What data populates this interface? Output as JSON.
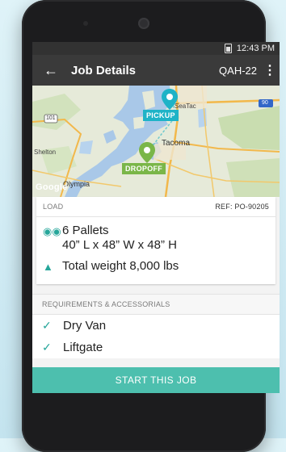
{
  "status": {
    "time": "12:43 PM"
  },
  "appbar": {
    "title": "Job Details",
    "job_code": "QAH-22"
  },
  "map": {
    "pickup_label": "PICKUP",
    "dropoff_label": "DROPOFF",
    "places": {
      "seatac": "SeaTac",
      "tacoma": "Tacoma",
      "shelton": "Shelton",
      "olympia": "Olympia",
      "hwy_101": "101",
      "hwy_90": "90"
    }
  },
  "load": {
    "header": "LOAD",
    "ref": "REF: PO-90205",
    "pallets": "6 Pallets",
    "dimensions": "40” L x 48” W x 48” H",
    "weight": "Total weight 8,000 lbs"
  },
  "requirements": {
    "header": "REQUIREMENTS & ACCESSORIALS",
    "items": [
      "Dry Van",
      "Liftgate"
    ]
  },
  "actions": {
    "start_label": "START THIS JOB"
  },
  "colors": {
    "accent": "#26a69a",
    "pickup": "#1eb3c7",
    "dropoff": "#7ab648",
    "button": "#4dbfae"
  }
}
